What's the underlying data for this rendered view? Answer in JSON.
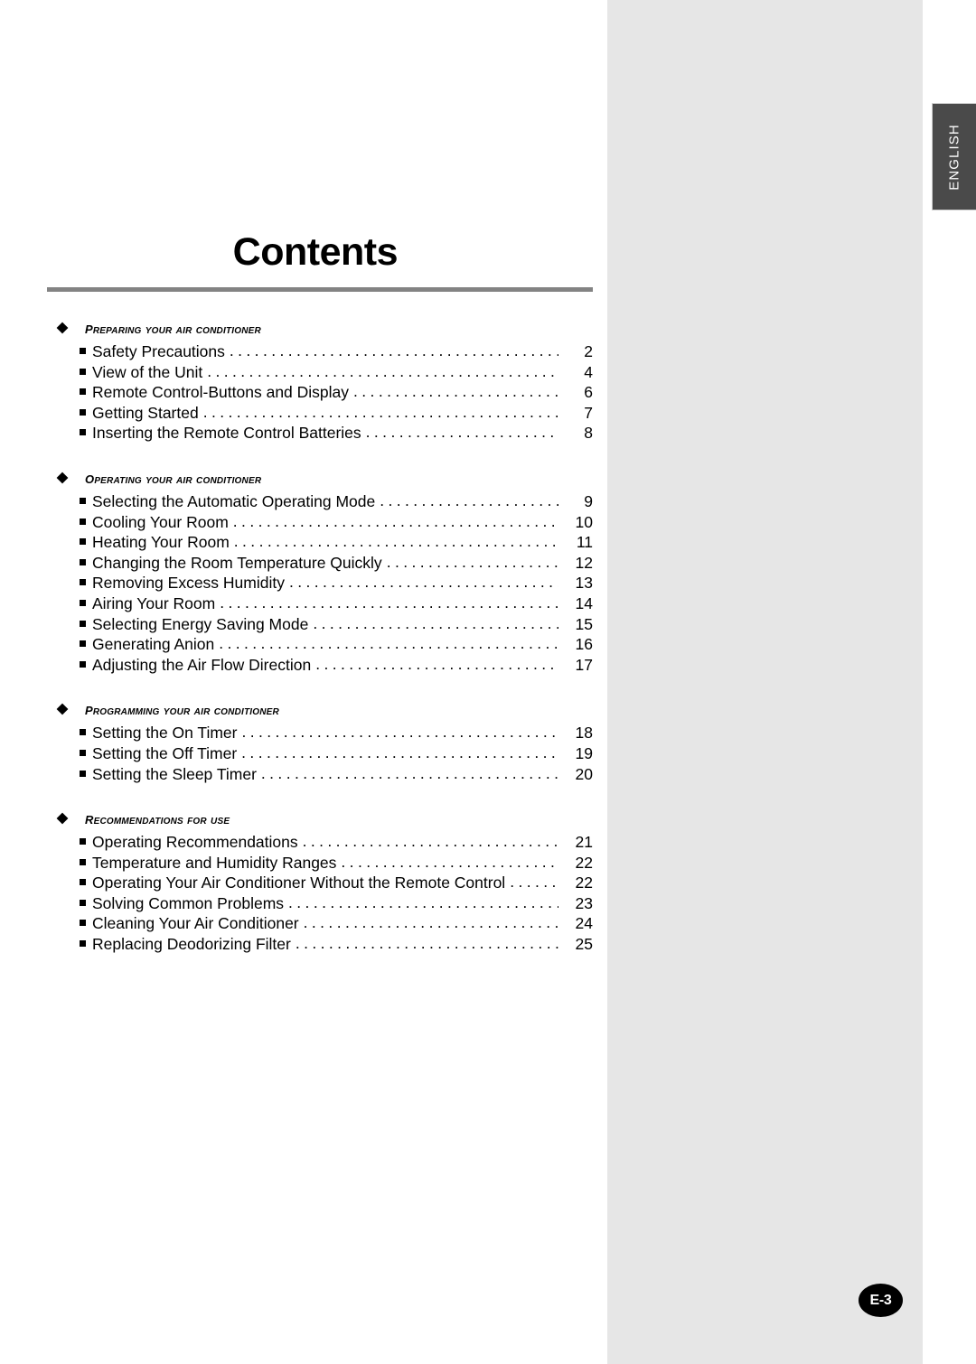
{
  "document": {
    "title": "Contents",
    "language_tab": "ENGLISH",
    "page_marker": "E-3"
  },
  "icons": {
    "section_bullet": "diamond-icon",
    "entry_bullet": "square-bullet-icon"
  },
  "colors": {
    "panel_gray": "#e6e6e6",
    "tab_dark": "#4a4a4a",
    "rule_gray": "#838383",
    "text_black": "#000000",
    "badge_black": "#000000"
  },
  "sections": [
    {
      "heading": "Preparing your air conditioner",
      "entries": [
        {
          "label": "Safety Precautions",
          "page": "2"
        },
        {
          "label": "View of the Unit",
          "page": "4"
        },
        {
          "label": "Remote Control-Buttons and Display",
          "page": "6"
        },
        {
          "label": "Getting Started",
          "page": "7"
        },
        {
          "label": "Inserting the Remote Control Batteries",
          "page": "8"
        }
      ]
    },
    {
      "heading": "Operating your air conditioner",
      "entries": [
        {
          "label": "Selecting the Automatic Operating Mode",
          "page": "9"
        },
        {
          "label": "Cooling Your Room",
          "page": "10"
        },
        {
          "label": "Heating Your Room",
          "page": "11"
        },
        {
          "label": "Changing the Room Temperature Quickly",
          "page": "12"
        },
        {
          "label": "Removing Excess Humidity",
          "page": "13"
        },
        {
          "label": "Airing Your Room",
          "page": "14"
        },
        {
          "label": "Selecting Energy Saving Mode",
          "page": "15"
        },
        {
          "label": "Generating Anion",
          "page": "16"
        },
        {
          "label": "Adjusting the Air Flow Direction",
          "page": "17"
        }
      ]
    },
    {
      "heading": "Programming your air conditioner",
      "entries": [
        {
          "label": "Setting the On Timer",
          "page": "18"
        },
        {
          "label": "Setting the Off Timer",
          "page": "19"
        },
        {
          "label": "Setting the Sleep Timer",
          "page": "20"
        }
      ]
    },
    {
      "heading": "Recommendations for use",
      "entries": [
        {
          "label": "Operating Recommendations",
          "page": "21"
        },
        {
          "label": "Temperature and Humidity Ranges",
          "page": "22"
        },
        {
          "label": "Operating Your Air Conditioner Without the Remote Control",
          "page": "22"
        },
        {
          "label": "Solving Common Problems",
          "page": "23"
        },
        {
          "label": "Cleaning Your Air Conditioner",
          "page": "24"
        },
        {
          "label": "Replacing Deodorizing Filter",
          "page": "25"
        }
      ]
    }
  ]
}
